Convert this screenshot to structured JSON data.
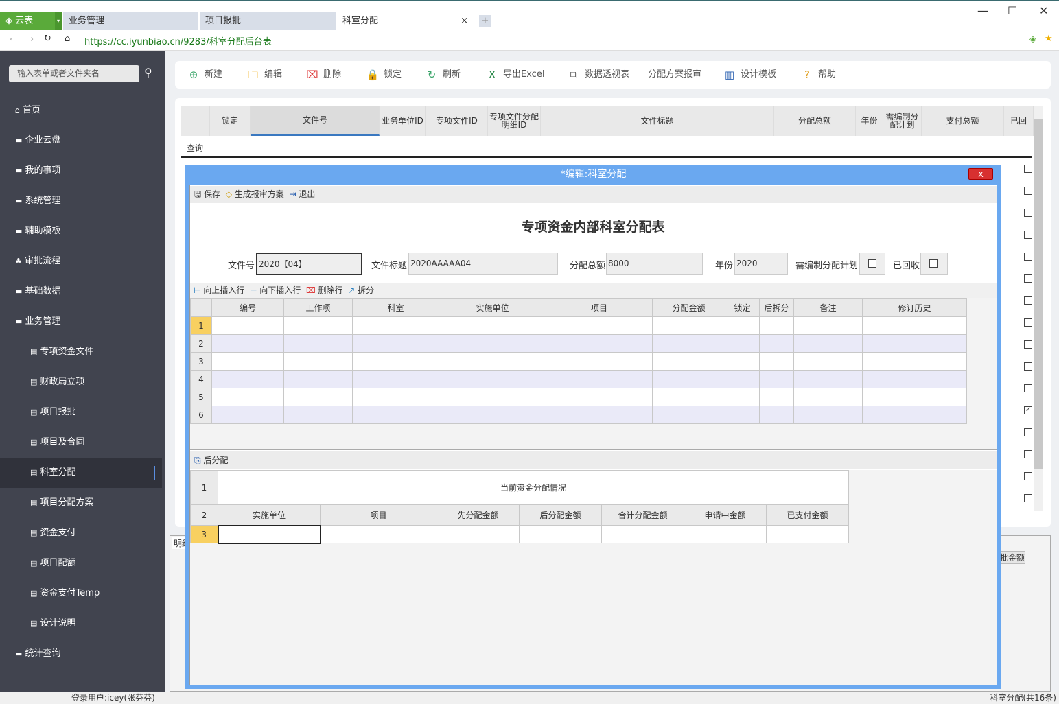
{
  "browser": {
    "brand": "云表",
    "tabs": [
      "业务管理",
      "项目报批",
      "科室分配"
    ],
    "url": "https://cc.iyunbiao.cn/9283/科室分配后台表"
  },
  "sidebar": {
    "search_placeholder": "输入表单或者文件夹名",
    "items": [
      {
        "label": "首页",
        "icon": "home-icon"
      },
      {
        "label": "企业云盘",
        "icon": "folder-icon"
      },
      {
        "label": "我的事项",
        "icon": "folder-icon"
      },
      {
        "label": "系统管理",
        "icon": "folder-icon"
      },
      {
        "label": "辅助模板",
        "icon": "folder-icon"
      },
      {
        "label": "审批流程",
        "icon": "sitemap-icon"
      },
      {
        "label": "基础数据",
        "icon": "folder-icon"
      },
      {
        "label": "业务管理",
        "icon": "folder-icon"
      },
      {
        "label": "专项资金文件",
        "icon": "doc-icon",
        "sub": true
      },
      {
        "label": "财政局立项",
        "icon": "doc-icon",
        "sub": true
      },
      {
        "label": "项目报批",
        "icon": "doc-icon",
        "sub": true
      },
      {
        "label": "项目及合同",
        "icon": "doc-icon",
        "sub": true
      },
      {
        "label": "科室分配",
        "icon": "doc-icon",
        "sub": true,
        "active": true
      },
      {
        "label": "项目分配方案",
        "icon": "doc-icon",
        "sub": true
      },
      {
        "label": "资金支付",
        "icon": "doc-icon",
        "sub": true
      },
      {
        "label": "项目配额",
        "icon": "doc-icon",
        "sub": true
      },
      {
        "label": "资金支付Temp",
        "icon": "doc-icon",
        "sub": true
      },
      {
        "label": "设计说明",
        "icon": "doc-icon",
        "sub": true
      },
      {
        "label": "统计查询",
        "icon": "folder-icon"
      }
    ]
  },
  "toolbar": [
    {
      "label": "新建",
      "icon": "plus-circle-icon",
      "color": "#3aa56a"
    },
    {
      "label": "编辑",
      "icon": "folder-open-icon",
      "color": "#f0b020"
    },
    {
      "label": "删除",
      "icon": "delete-icon",
      "color": "#d33"
    },
    {
      "label": "锁定",
      "icon": "lock-icon",
      "color": "#e0a020"
    },
    {
      "label": "刷新",
      "icon": "refresh-icon",
      "color": "#3aa56a"
    },
    {
      "label": "导出Excel",
      "icon": "excel-icon",
      "color": "#2a8a4a"
    },
    {
      "label": "数据透视表",
      "icon": "pivot-icon",
      "color": "#555"
    },
    {
      "label": "分配方案报审",
      "icon": "",
      "color": "#555"
    },
    {
      "label": "设计模板",
      "icon": "design-icon",
      "color": "#2a60b0"
    },
    {
      "label": "帮助",
      "icon": "help-icon",
      "color": "#e0a020"
    }
  ],
  "main_grid": {
    "headers": [
      "锁定",
      "文件号",
      "业务单位ID",
      "专项文件ID",
      "专项文件分配明细ID",
      "文件标题",
      "分配总额",
      "年份",
      "需编制分配计划",
      "支付总额",
      "已回"
    ],
    "query_label": "查询",
    "checked_rows": [
      11
    ]
  },
  "detail_tab": "明细",
  "detail_partial_header": "批金额",
  "modal": {
    "title": "*编辑:科室分配",
    "close": "X",
    "actions": [
      "保存",
      "生成报审方案",
      "退出"
    ],
    "form_title": "专项资金内部科室分配表",
    "fields": {
      "file_no_label": "文件号",
      "file_no": "2020【04】",
      "title_label": "文件标题",
      "title": "2020AAAAA04",
      "total_label": "分配总额",
      "total": "8000",
      "year_label": "年份",
      "year": "2020",
      "plan_label": "需编制分配计划",
      "recovered_label": "已回收"
    },
    "row_actions": [
      "向上插入行",
      "向下插入行",
      "删除行",
      "拆分"
    ],
    "detail_headers": [
      "编号",
      "工作项",
      "科室",
      "实施单位",
      "项目",
      "分配金额",
      "锁定",
      "后拆分",
      "备注",
      "修订历史"
    ],
    "row_numbers": [
      "1",
      "2",
      "3",
      "4",
      "5",
      "6"
    ],
    "post_section": "后分配",
    "post_title": "当前资金分配情况",
    "post_headers": [
      "实施单位",
      "项目",
      "先分配金额",
      "后分配金额",
      "合计分配金额",
      "申请中金额",
      "已支付金额"
    ],
    "post_rows": [
      "1",
      "2",
      "3"
    ]
  },
  "status": {
    "user": "登录用户:icey(张芬芬)",
    "count": "科室分配(共16条)"
  }
}
